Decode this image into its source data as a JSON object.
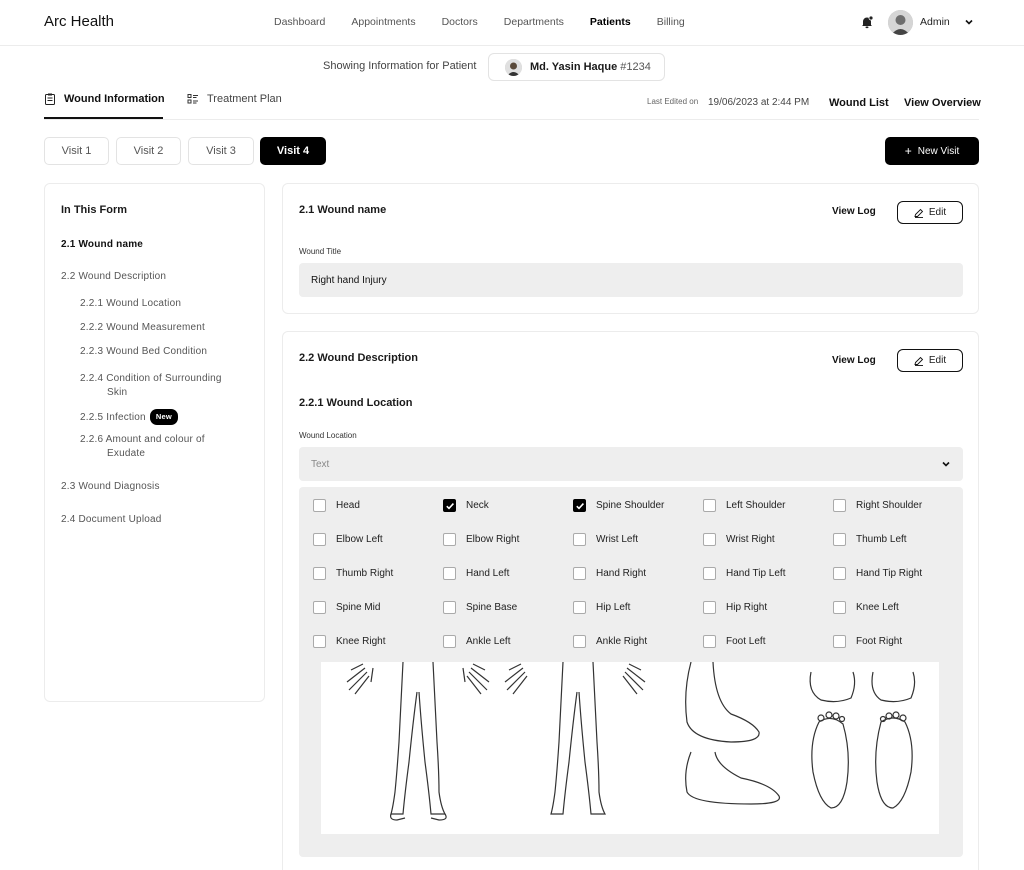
{
  "app": {
    "brand": "Arc Health"
  },
  "nav": {
    "items": [
      "Dashboard",
      "Appointments",
      "Doctors",
      "Departments",
      "Patients",
      "Billing"
    ],
    "active_index": 4
  },
  "user": {
    "name": "Admin"
  },
  "patient": {
    "showing_label": "Showing Information for Patient",
    "name": "Md. Yasin Haque",
    "id": "#1234"
  },
  "tabs": {
    "wound": "Wound Information",
    "treatment": "Treatment Plan"
  },
  "meta": {
    "last_edited_label": "Last Edited on",
    "last_edited_value": "19/06/2023 at 2:44 PM",
    "wound_list": "Wound List",
    "view_overview": "View Overview"
  },
  "visits": {
    "items": [
      "Visit 1",
      "Visit 2",
      "Visit 3",
      "Visit 4"
    ],
    "active_index": 3,
    "new_visit": "New Visit"
  },
  "form_nav": {
    "header": "In This Form",
    "s21": "2.1 Wound name",
    "s22": "2.2 Wound Description",
    "s221": "2.2.1 Wound Location",
    "s222": "2.2.2 Wound Measurement",
    "s223": "2.2.3 Wound Bed Condition",
    "s224a": "2.2.4 Condition of Surrounding",
    "s224b": "Skin",
    "s225": "2.2.5 Infection",
    "new_badge": "New",
    "s226a": "2.2.6 Amount and colour of",
    "s226b": "Exudate",
    "s23": "2.3 Wound Diagnosis",
    "s24": "2.4 Document Upload"
  },
  "card1": {
    "title": "2.1 Wound name",
    "view_log": "View Log",
    "edit": "Edit",
    "field_label": "Wound Title",
    "field_value": "Right hand Injury"
  },
  "card2": {
    "title": "2.2 Wound Description",
    "view_log": "View Log",
    "edit": "Edit",
    "subtitle": "2.2.1 Wound Location",
    "field_label": "Wound Location",
    "select_placeholder": "Text"
  },
  "locations": {
    "rows": [
      [
        {
          "label": "Head",
          "checked": false
        },
        {
          "label": "Neck",
          "checked": true
        },
        {
          "label": "Spine Shoulder",
          "checked": true
        },
        {
          "label": "Left Shoulder",
          "checked": false
        },
        {
          "label": "Right Shoulder",
          "checked": false
        }
      ],
      [
        {
          "label": "Elbow Left",
          "checked": false
        },
        {
          "label": "Elbow Right",
          "checked": false
        },
        {
          "label": "Wrist Left",
          "checked": false
        },
        {
          "label": "Wrist Right",
          "checked": false
        },
        {
          "label": "Thumb Left",
          "checked": false
        }
      ],
      [
        {
          "label": "Thumb Right",
          "checked": false
        },
        {
          "label": "Hand Left",
          "checked": false
        },
        {
          "label": "Hand Right",
          "checked": false
        },
        {
          "label": "Hand Tip Left",
          "checked": false
        },
        {
          "label": "Hand Tip Right",
          "checked": false
        }
      ],
      [
        {
          "label": "Spine Mid",
          "checked": false
        },
        {
          "label": "Spine Base",
          "checked": false
        },
        {
          "label": "Hip Left",
          "checked": false
        },
        {
          "label": "Hip Right",
          "checked": false
        },
        {
          "label": "Knee Left",
          "checked": false
        }
      ],
      [
        {
          "label": "Knee Right",
          "checked": false
        },
        {
          "label": "Ankle Left",
          "checked": false
        },
        {
          "label": "Ankle Right",
          "checked": false
        },
        {
          "label": "Foot Left",
          "checked": false
        },
        {
          "label": "Foot Right",
          "checked": false
        }
      ]
    ]
  }
}
